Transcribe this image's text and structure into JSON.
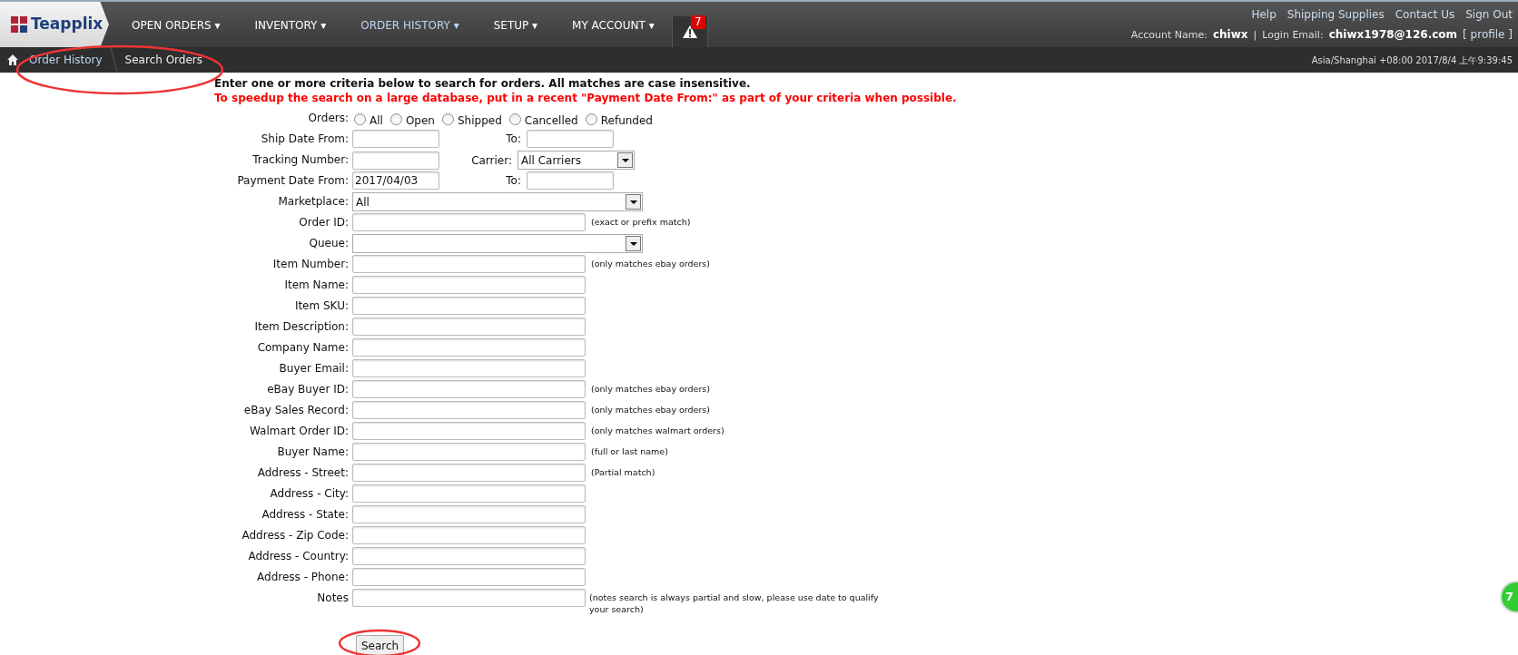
{
  "nav": {
    "logo": "Teapplix",
    "items": [
      {
        "label": "OPEN ORDERS ▾",
        "selected": false
      },
      {
        "label": "INVENTORY ▾",
        "selected": false
      },
      {
        "label": "ORDER HISTORY ▾",
        "selected": true
      },
      {
        "label": "SETUP ▾",
        "selected": false
      },
      {
        "label": "MY ACCOUNT ▾",
        "selected": false
      }
    ],
    "alert_count": "7"
  },
  "top_links": [
    "Help",
    "Shipping Supplies",
    "Contact Us",
    "Sign Out"
  ],
  "account": {
    "name_label": "Account Name:",
    "name": "chiwx",
    "separator": "|",
    "email_label": "Login Email:",
    "email": "chiwx1978@126.com",
    "profile": "[ profile ]"
  },
  "breadcrumb": [
    "Order History",
    "Search Orders"
  ],
  "timestamp": "Asia/Shanghai +08:00 2017/8/4 上午9:39:45",
  "intro": "Enter one or more criteria below to search for orders. All matches are case insensitive.",
  "warning": "To speedup the search on a large database, put in a recent \"Payment Date From:\" as part of your criteria when possible.",
  "form": [
    {
      "kind": "radios",
      "label": "Orders:",
      "options": [
        {
          "label": "All",
          "selected": false
        },
        {
          "label": "Open",
          "selected": false
        },
        {
          "label": "Shipped",
          "selected": false
        },
        {
          "label": "Cancelled",
          "selected": false
        },
        {
          "label": "Refunded",
          "selected": false
        }
      ]
    },
    {
      "kind": "range",
      "label": "Ship Date From:",
      "to_label": "To:"
    },
    {
      "kind": "text_select",
      "label": "Tracking Number:",
      "select_label": "Carrier:",
      "select_value": "All Carriers"
    },
    {
      "kind": "range",
      "label": "Payment Date From:",
      "value": "2017/04/03",
      "to_label": "To:"
    },
    {
      "kind": "select",
      "label": "Marketplace:",
      "value": "All"
    },
    {
      "kind": "text",
      "label": "Order ID:",
      "note": "(exact or prefix match)"
    },
    {
      "kind": "select",
      "label": "Queue:"
    },
    {
      "kind": "text",
      "label": "Item Number:",
      "note": "(only matches ebay orders)"
    },
    {
      "kind": "text",
      "label": "Item Name:"
    },
    {
      "kind": "text",
      "label": "Item SKU:"
    },
    {
      "kind": "text",
      "label": "Item Description:"
    },
    {
      "kind": "text",
      "label": "Company Name:"
    },
    {
      "kind": "text",
      "label": "Buyer Email:"
    },
    {
      "kind": "text",
      "label": "eBay Buyer ID:",
      "note": "(only matches ebay orders)"
    },
    {
      "kind": "text",
      "label": "eBay Sales Record:",
      "note": "(only matches ebay orders)"
    },
    {
      "kind": "text",
      "label": "Walmart Order ID:",
      "note": "(only matches walmart orders)"
    },
    {
      "kind": "text",
      "label": "Buyer Name:",
      "note": "(full or last name)"
    },
    {
      "kind": "text",
      "label": "Address - Street:",
      "note": "(Partial match)"
    },
    {
      "kind": "text",
      "label": "Address - City:"
    },
    {
      "kind": "text",
      "label": "Address - State:"
    },
    {
      "kind": "text",
      "label": "Address - Zip Code:"
    },
    {
      "kind": "text",
      "label": "Address - Country:"
    },
    {
      "kind": "text",
      "label": "Address - Phone:"
    },
    {
      "kind": "notes",
      "label": "Notes",
      "note": "(notes search is always partial and slow, please use date to qualify your search)"
    }
  ],
  "search_button": "Search",
  "floating_badge": "7"
}
